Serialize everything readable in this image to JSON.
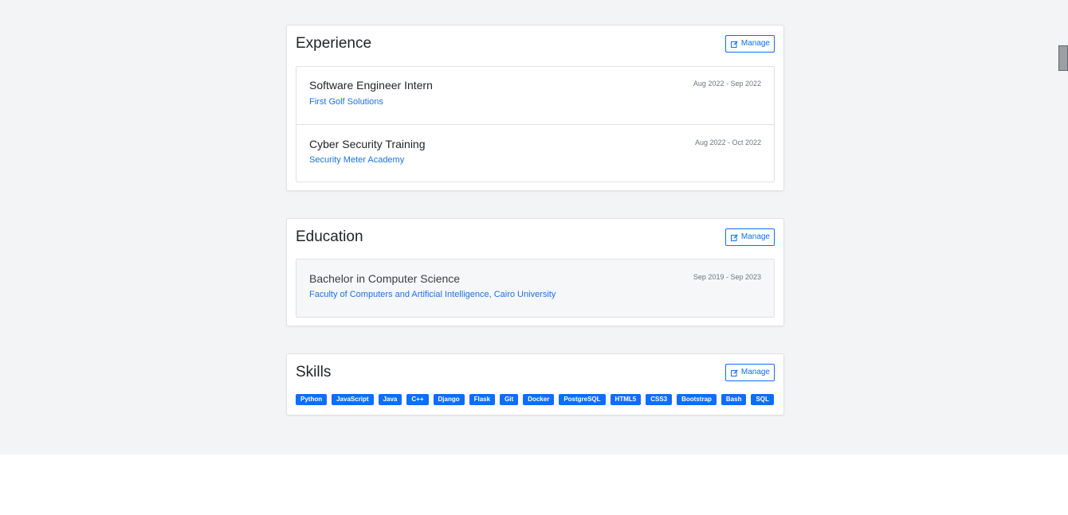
{
  "experience": {
    "title": "Experience",
    "manage_label": "Manage",
    "items": [
      {
        "title": "Software Engineer Intern",
        "org": "First Golf Solutions",
        "dates": "Aug 2022 - Sep 2022"
      },
      {
        "title": "Cyber Security Training",
        "org": "Security Meter Academy",
        "dates": "Aug 2022 - Oct 2022"
      }
    ]
  },
  "education": {
    "title": "Education",
    "manage_label": "Manage",
    "items": [
      {
        "title": "Bachelor in Computer Science",
        "org": "Faculty of Computers and Artificial Intelligence, Cairo University",
        "dates": "Sep 2019 - Sep 2023"
      }
    ]
  },
  "skills": {
    "title": "Skills",
    "manage_label": "Manage",
    "items": [
      "Python",
      "JavaScript",
      "Java",
      "C++",
      "Django",
      "Flask",
      "Git",
      "Docker",
      "PostgreSQL",
      "HTML5",
      "CSS3",
      "Bootstrap",
      "Bash",
      "SQL"
    ]
  },
  "colors": {
    "accent": "#0d6efd",
    "link": "#1a73e8",
    "page_background": "#f3f4f6"
  },
  "icons": {
    "manage": "edit-icon"
  }
}
